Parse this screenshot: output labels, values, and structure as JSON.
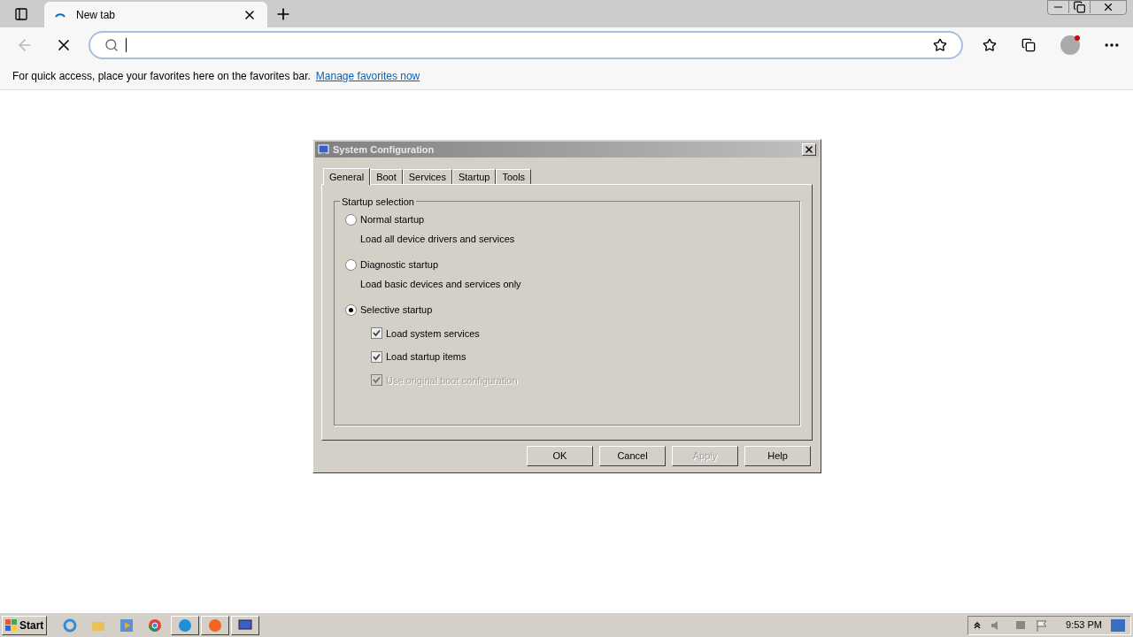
{
  "browser": {
    "tab": {
      "title": "New tab"
    },
    "favorites_bar": {
      "message": "For quick access, place your favorites here on the favorites bar.",
      "link": "Manage favorites now"
    }
  },
  "dialog": {
    "title": "System Configuration",
    "tabs": [
      {
        "label": "General",
        "selected": true
      },
      {
        "label": "Boot",
        "selected": false
      },
      {
        "label": "Services",
        "selected": false
      },
      {
        "label": "Startup",
        "selected": false
      },
      {
        "label": "Tools",
        "selected": false
      }
    ],
    "group": "Startup selection",
    "options": [
      {
        "label": "Normal startup",
        "description": "Load all device drivers and services",
        "selected": false
      },
      {
        "label": "Diagnostic startup",
        "description": "Load basic devices and services only",
        "selected": false
      },
      {
        "label": "Selective startup",
        "selected": true
      }
    ],
    "checks": [
      {
        "label": "Load system services",
        "checked": true,
        "disabled": false
      },
      {
        "label": "Load startup items",
        "checked": true,
        "disabled": false
      },
      {
        "label": "Use original boot configuration",
        "checked": true,
        "disabled": true
      }
    ],
    "buttons": [
      {
        "label": "OK",
        "disabled": false
      },
      {
        "label": "Cancel",
        "disabled": false
      },
      {
        "label": "Apply",
        "disabled": true
      },
      {
        "label": "Help",
        "disabled": false
      }
    ]
  },
  "taskbar": {
    "start": "Start",
    "clock": "9:53 PM"
  }
}
